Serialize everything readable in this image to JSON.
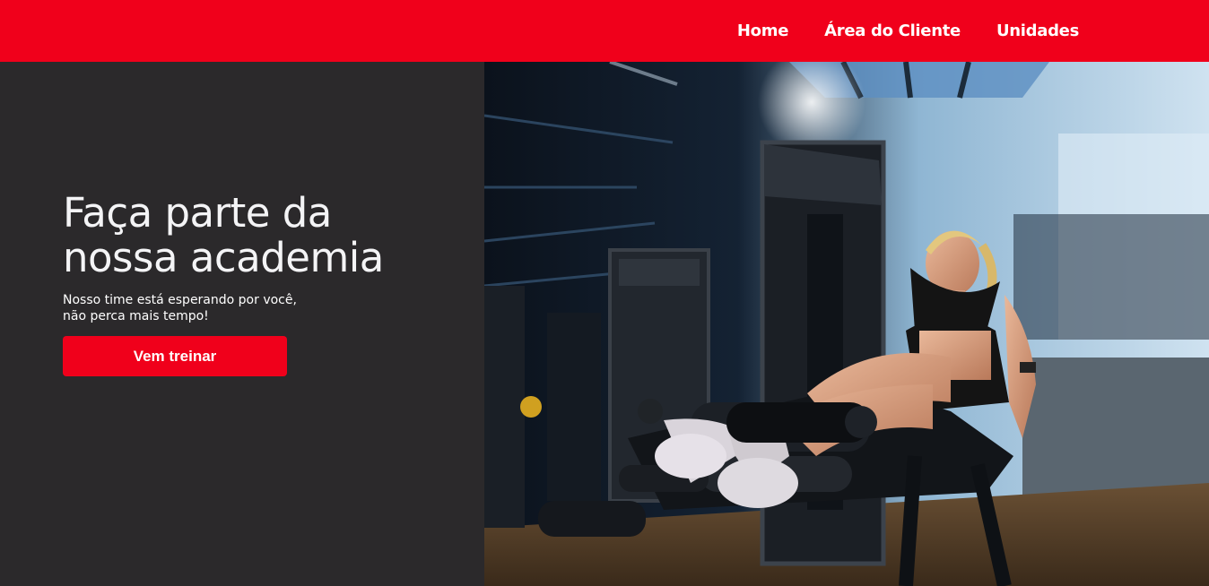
{
  "nav": {
    "items": [
      {
        "label": "Home"
      },
      {
        "label": "Área do Cliente"
      },
      {
        "label": "Unidades"
      }
    ]
  },
  "hero": {
    "title_line1": "Faça parte da",
    "title_line2": "nossa academia",
    "subtitle_line1": "Nosso time está esperando por você,",
    "subtitle_line2": "não perca mais tempo!",
    "cta_label": "Vem treinar"
  },
  "colors": {
    "brand_red": "#f0001b",
    "dark_bg": "#2b292b"
  },
  "image": {
    "semantic": "gym-photo"
  }
}
